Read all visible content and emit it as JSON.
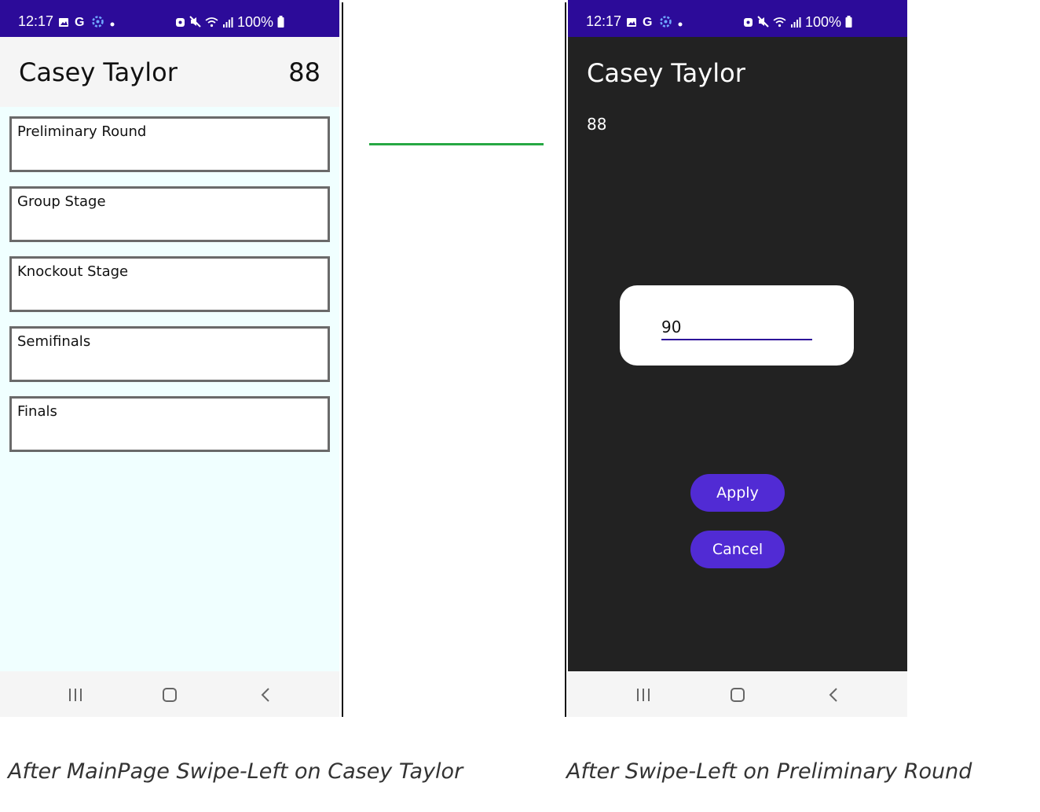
{
  "status": {
    "time": "12:17",
    "battery": "100%"
  },
  "left_screen": {
    "player_name": "Casey Taylor",
    "player_score": "88",
    "rounds": [
      "Preliminary Round",
      "Group Stage",
      "Knockout Stage",
      "Semifinals",
      "Finals"
    ]
  },
  "right_screen": {
    "player_name": "Casey Taylor",
    "player_score": "88",
    "dialog": {
      "input_value": "90"
    },
    "apply_label": "Apply",
    "cancel_label": "Cancel"
  },
  "captions": {
    "left": "After MainPage Swipe-Left on Casey Taylor",
    "right": "After Swipe-Left on Preliminary Round"
  },
  "colors": {
    "status_bar": "#2c0b99",
    "accent": "#512bd4",
    "arrow": "#27a844",
    "left_bg": "#f0ffff",
    "right_bg": "#222222"
  },
  "icons": {
    "status_left": [
      "photo-icon",
      "google-icon",
      "gear-icon",
      "dot-icon"
    ],
    "status_right": [
      "alarm-icon",
      "mute-icon",
      "wifi-icon",
      "signal-icon",
      "battery-icon"
    ],
    "nav": [
      "recents-icon",
      "home-icon",
      "back-icon"
    ]
  }
}
